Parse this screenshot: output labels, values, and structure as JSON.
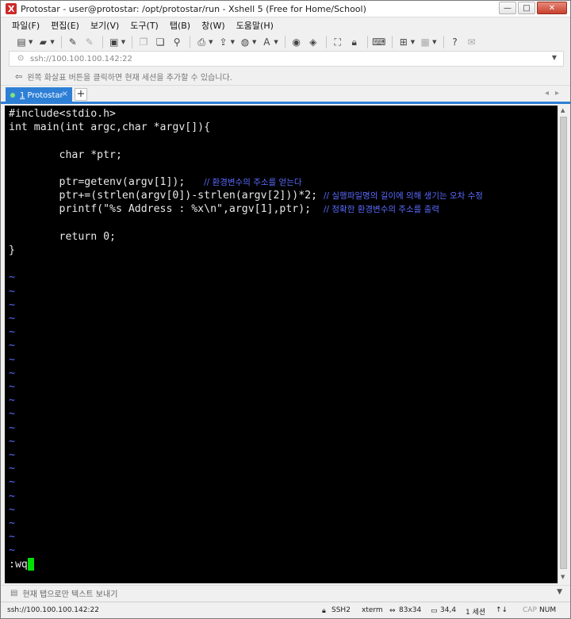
{
  "window": {
    "title": "Protostar - user@protostar: /opt/protostar/run - Xshell 5 (Free for Home/School)",
    "controls": [
      "—",
      "□",
      "✕"
    ]
  },
  "menu": [
    "파일(F)",
    "편집(E)",
    "보기(V)",
    "도구(T)",
    "탭(B)",
    "창(W)",
    "도움말(H)"
  ],
  "address": {
    "value": "ssh://100.100.100.142:22"
  },
  "hint": {
    "text": "왼쪽 화살표 버튼을 클릭하면 현재 세션을 추가할 수 있습니다."
  },
  "tabs": [
    {
      "number": "1",
      "label": "Protostar",
      "close": "×"
    }
  ],
  "tab_add": "+",
  "terminal": {
    "lines": [
      {
        "code": "#include<stdio.h>",
        "comment": ""
      },
      {
        "code": "int main(int argc,char *argv[]){",
        "comment": ""
      },
      {
        "code": "",
        "comment": ""
      },
      {
        "code": "        char *ptr;",
        "comment": ""
      },
      {
        "code": "",
        "comment": ""
      },
      {
        "code": "        ptr=getenv(argv[1]);   ",
        "comment": "// 환경변수의 주소를 얻는다"
      },
      {
        "code": "        ptr+=(strlen(argv[0])-strlen(argv[2]))*2; ",
        "comment": "// 실행파일명의 길이에 의해 생기는 오차 수정"
      },
      {
        "code": "        printf(\"%s Address : %x\\n\",argv[1],ptr);  ",
        "comment": "// 정확한 환경변수의 주소를 출력"
      },
      {
        "code": "",
        "comment": ""
      },
      {
        "code": "        return 0;",
        "comment": ""
      },
      {
        "code": "}",
        "comment": ""
      }
    ],
    "tilde_char": "~",
    "tilde_count": 21,
    "command": ":wq",
    "colors": {
      "background": "#000000",
      "text": "#e8e8e8",
      "comment": "#5a6bff",
      "cursor": "#00e000"
    }
  },
  "compose": {
    "text": "현재 탭으로만 텍스트 보내기"
  },
  "status": {
    "connection": "ssh://100.100.100.142:22",
    "protocol": "SSH2",
    "terminal_type": "xterm",
    "size": "83x34",
    "cursor_pos": "34,4",
    "sessions": "1 세션",
    "cap": "CAP",
    "num": "NUM"
  },
  "accent_color": "#2d7fd6"
}
